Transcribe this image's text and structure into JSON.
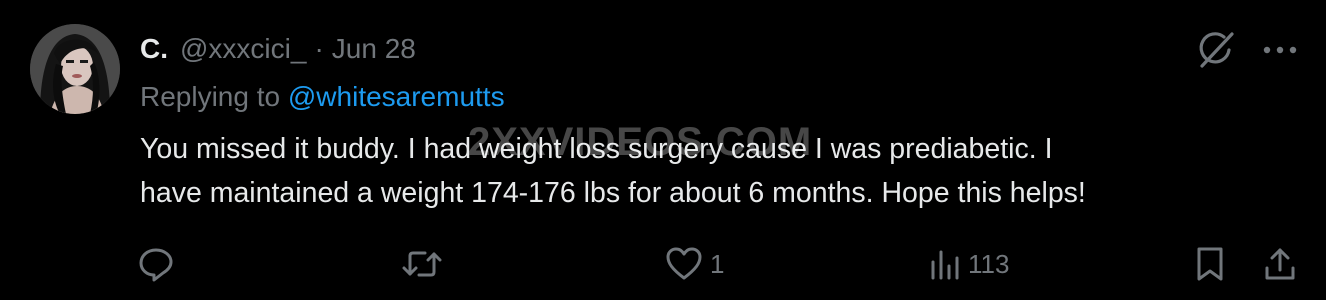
{
  "tweet": {
    "display_name": "C.",
    "handle": "@xxxcici_",
    "separator": "·",
    "date": "Jun 28",
    "reply_prefix": "Replying to",
    "reply_to": "@whitesaremutts",
    "body_line1": "You missed it buddy. I had weight loss surgery cause I was prediabetic. I",
    "body_line2": "have maintained a weight 174-176 lbs for about 6 months. Hope this helps!"
  },
  "watermark": "2XXVIDEOS.COM",
  "actions": {
    "reply_icon": "reply-icon",
    "retweet_icon": "retweet-icon",
    "like_icon": "heart-icon",
    "like_count": "1",
    "views_icon": "views-icon",
    "views_count": "113",
    "bookmark_icon": "bookmark-icon",
    "share_icon": "share-icon"
  },
  "top_icons": [
    "grok-icon",
    "more-icon"
  ],
  "colors": {
    "background": "#000000",
    "text_primary": "#e7e9ea",
    "text_secondary": "#71767b",
    "link": "#1d9bf0"
  }
}
